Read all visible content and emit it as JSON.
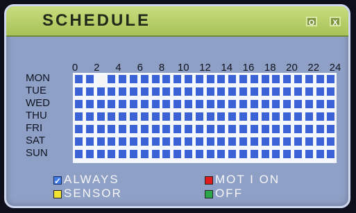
{
  "window": {
    "title": "SCHEDULE",
    "buttons": {
      "ok": "O",
      "close": "X"
    }
  },
  "grid": {
    "hour_labels": [
      "0",
      "2",
      "4",
      "6",
      "8",
      "10",
      "12",
      "14",
      "16",
      "18",
      "20",
      "22",
      "24"
    ],
    "days": [
      "MON",
      "TUE",
      "WED",
      "THU",
      "FRI",
      "SAT",
      "SUN"
    ],
    "selected_cell": {
      "day": "MON",
      "hour_index": 2
    },
    "cell_colors": {
      "default": "#3c63d6",
      "selected": "#f5f5f5"
    }
  },
  "legend": {
    "always": {
      "label": "ALWAYS",
      "color": "#3f7be6",
      "checked": true
    },
    "sensor": {
      "label": "SENSOR",
      "color": "#f2e333"
    },
    "motion": {
      "label": "MOT I ON",
      "color": "#e11b1b"
    },
    "off": {
      "label": "OFF",
      "color": "#2ca84a"
    }
  }
}
